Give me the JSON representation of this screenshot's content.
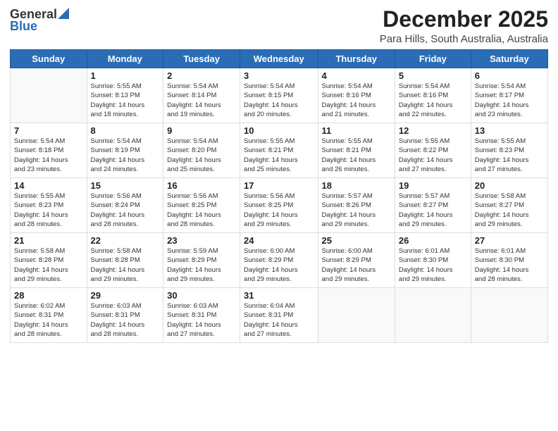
{
  "logo": {
    "line1": "General",
    "line2": "Blue"
  },
  "title": "December 2025",
  "subtitle": "Para Hills, South Australia, Australia",
  "days": [
    "Sunday",
    "Monday",
    "Tuesday",
    "Wednesday",
    "Thursday",
    "Friday",
    "Saturday"
  ],
  "weeks": [
    [
      {
        "date": "",
        "info": ""
      },
      {
        "date": "1",
        "info": "Sunrise: 5:55 AM\nSunset: 8:13 PM\nDaylight: 14 hours\nand 18 minutes."
      },
      {
        "date": "2",
        "info": "Sunrise: 5:54 AM\nSunset: 8:14 PM\nDaylight: 14 hours\nand 19 minutes."
      },
      {
        "date": "3",
        "info": "Sunrise: 5:54 AM\nSunset: 8:15 PM\nDaylight: 14 hours\nand 20 minutes."
      },
      {
        "date": "4",
        "info": "Sunrise: 5:54 AM\nSunset: 8:16 PM\nDaylight: 14 hours\nand 21 minutes."
      },
      {
        "date": "5",
        "info": "Sunrise: 5:54 AM\nSunset: 8:16 PM\nDaylight: 14 hours\nand 22 minutes."
      },
      {
        "date": "6",
        "info": "Sunrise: 5:54 AM\nSunset: 8:17 PM\nDaylight: 14 hours\nand 23 minutes."
      }
    ],
    [
      {
        "date": "7",
        "info": "Sunrise: 5:54 AM\nSunset: 8:18 PM\nDaylight: 14 hours\nand 23 minutes."
      },
      {
        "date": "8",
        "info": "Sunrise: 5:54 AM\nSunset: 8:19 PM\nDaylight: 14 hours\nand 24 minutes."
      },
      {
        "date": "9",
        "info": "Sunrise: 5:54 AM\nSunset: 8:20 PM\nDaylight: 14 hours\nand 25 minutes."
      },
      {
        "date": "10",
        "info": "Sunrise: 5:55 AM\nSunset: 8:21 PM\nDaylight: 14 hours\nand 25 minutes."
      },
      {
        "date": "11",
        "info": "Sunrise: 5:55 AM\nSunset: 8:21 PM\nDaylight: 14 hours\nand 26 minutes."
      },
      {
        "date": "12",
        "info": "Sunrise: 5:55 AM\nSunset: 8:22 PM\nDaylight: 14 hours\nand 27 minutes."
      },
      {
        "date": "13",
        "info": "Sunrise: 5:55 AM\nSunset: 8:23 PM\nDaylight: 14 hours\nand 27 minutes."
      }
    ],
    [
      {
        "date": "14",
        "info": "Sunrise: 5:55 AM\nSunset: 8:23 PM\nDaylight: 14 hours\nand 28 minutes."
      },
      {
        "date": "15",
        "info": "Sunrise: 5:56 AM\nSunset: 8:24 PM\nDaylight: 14 hours\nand 28 minutes."
      },
      {
        "date": "16",
        "info": "Sunrise: 5:56 AM\nSunset: 8:25 PM\nDaylight: 14 hours\nand 28 minutes."
      },
      {
        "date": "17",
        "info": "Sunrise: 5:56 AM\nSunset: 8:25 PM\nDaylight: 14 hours\nand 29 minutes."
      },
      {
        "date": "18",
        "info": "Sunrise: 5:57 AM\nSunset: 8:26 PM\nDaylight: 14 hours\nand 29 minutes."
      },
      {
        "date": "19",
        "info": "Sunrise: 5:57 AM\nSunset: 8:27 PM\nDaylight: 14 hours\nand 29 minutes."
      },
      {
        "date": "20",
        "info": "Sunrise: 5:58 AM\nSunset: 8:27 PM\nDaylight: 14 hours\nand 29 minutes."
      }
    ],
    [
      {
        "date": "21",
        "info": "Sunrise: 5:58 AM\nSunset: 8:28 PM\nDaylight: 14 hours\nand 29 minutes."
      },
      {
        "date": "22",
        "info": "Sunrise: 5:58 AM\nSunset: 8:28 PM\nDaylight: 14 hours\nand 29 minutes."
      },
      {
        "date": "23",
        "info": "Sunrise: 5:59 AM\nSunset: 8:29 PM\nDaylight: 14 hours\nand 29 minutes."
      },
      {
        "date": "24",
        "info": "Sunrise: 6:00 AM\nSunset: 8:29 PM\nDaylight: 14 hours\nand 29 minutes."
      },
      {
        "date": "25",
        "info": "Sunrise: 6:00 AM\nSunset: 8:29 PM\nDaylight: 14 hours\nand 29 minutes."
      },
      {
        "date": "26",
        "info": "Sunrise: 6:01 AM\nSunset: 8:30 PM\nDaylight: 14 hours\nand 29 minutes."
      },
      {
        "date": "27",
        "info": "Sunrise: 6:01 AM\nSunset: 8:30 PM\nDaylight: 14 hours\nand 28 minutes."
      }
    ],
    [
      {
        "date": "28",
        "info": "Sunrise: 6:02 AM\nSunset: 8:31 PM\nDaylight: 14 hours\nand 28 minutes."
      },
      {
        "date": "29",
        "info": "Sunrise: 6:03 AM\nSunset: 8:31 PM\nDaylight: 14 hours\nand 28 minutes."
      },
      {
        "date": "30",
        "info": "Sunrise: 6:03 AM\nSunset: 8:31 PM\nDaylight: 14 hours\nand 27 minutes."
      },
      {
        "date": "31",
        "info": "Sunrise: 6:04 AM\nSunset: 8:31 PM\nDaylight: 14 hours\nand 27 minutes."
      },
      {
        "date": "",
        "info": ""
      },
      {
        "date": "",
        "info": ""
      },
      {
        "date": "",
        "info": ""
      }
    ]
  ]
}
